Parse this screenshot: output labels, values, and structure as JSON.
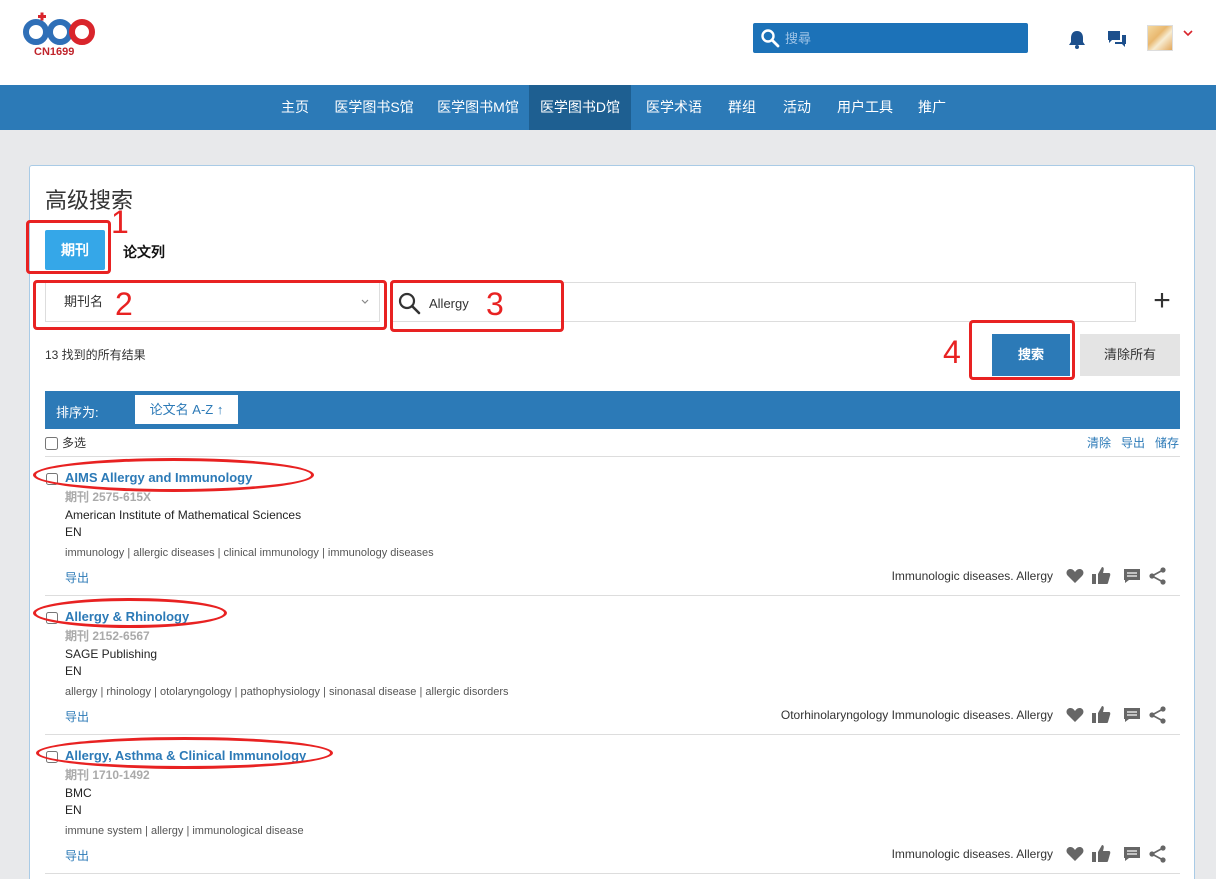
{
  "header": {
    "logo_text": "CN1699",
    "search_placeholder": "搜尋"
  },
  "nav": {
    "items": [
      "主页",
      "医学图书S馆",
      "医学图书M馆",
      "医学图书D馆",
      "医学术语",
      "群组",
      "活动",
      "用户工具",
      "推广"
    ],
    "active_index": 3
  },
  "panel": {
    "title": "高级搜索",
    "tabs": [
      "期刊",
      "论文列"
    ],
    "field_select": "期刊名",
    "query_value": "Allergy",
    "add_symbol": "+",
    "result_count": "13 找到的所有结果",
    "search_button": "搜索",
    "clear_button": "清除所有",
    "sort_label": "排序为:",
    "sort_option": "论文名 A-Z ↑",
    "multi_select": "多选",
    "tools": [
      "清除",
      "导出",
      "储存"
    ]
  },
  "results": [
    {
      "title": "AIMS Allergy and Immunology",
      "issn": "期刊 2575-615X",
      "publisher": "American Institute of Mathematical Sciences",
      "language": "EN",
      "keywords": "immunology | allergic diseases | clinical immunology | immunology diseases",
      "export": "导出",
      "subjects": "Immunologic diseases. Allergy"
    },
    {
      "title": "Allergy & Rhinology",
      "issn": "期刊 2152-6567",
      "publisher": "SAGE Publishing",
      "language": "EN",
      "keywords": "allergy | rhinology | otolaryngology | pathophysiology | sinonasal disease | allergic disorders",
      "export": "导出",
      "subjects": "Otorhinolaryngology  Immunologic diseases. Allergy"
    },
    {
      "title": "Allergy, Asthma & Clinical Immunology",
      "issn": "期刊 1710-1492",
      "publisher": "BMC",
      "language": "EN",
      "keywords": "immune system | allergy | immunological disease",
      "export": "导出",
      "subjects": "Immunologic diseases. Allergy"
    }
  ],
  "annotations": [
    "1",
    "2",
    "3",
    "4"
  ],
  "colors": {
    "nav": "#2c7ab7",
    "nav_active": "#1e5f91",
    "tab_active": "#35a7e8",
    "link": "#2c7ab7",
    "annotation": "#e82222"
  }
}
